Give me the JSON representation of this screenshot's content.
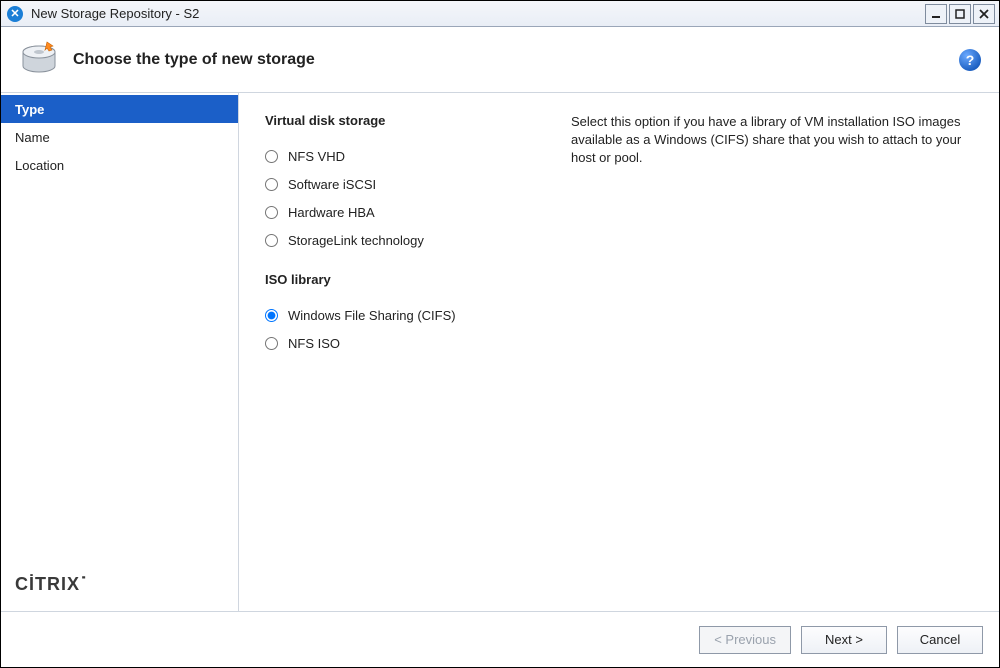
{
  "window": {
    "title": "New Storage Repository - S2"
  },
  "header": {
    "heading": "Choose the type of new storage"
  },
  "sidebar": {
    "steps": [
      {
        "label": "Type",
        "active": true
      },
      {
        "label": "Name",
        "active": false
      },
      {
        "label": "Location",
        "active": false
      }
    ],
    "brand": "CİTRIX"
  },
  "options": {
    "group1_title": "Virtual disk storage",
    "group1": [
      {
        "key": "nfs_vhd",
        "label": "NFS VHD",
        "selected": false
      },
      {
        "key": "sw_iscsi",
        "label": "Software iSCSI",
        "selected": false
      },
      {
        "key": "hw_hba",
        "label": "Hardware HBA",
        "selected": false
      },
      {
        "key": "storagelink",
        "label": "StorageLink technology",
        "selected": false
      }
    ],
    "group2_title": "ISO library",
    "group2": [
      {
        "key": "cifs",
        "label": "Windows File Sharing (CIFS)",
        "selected": true
      },
      {
        "key": "nfs_iso",
        "label": "NFS ISO",
        "selected": false
      }
    ]
  },
  "description": "Select this option if you have a library of VM installation ISO images available as a Windows (CIFS) share that you wish to attach to your host or pool.",
  "footer": {
    "previous": "< Previous",
    "next": "Next >",
    "cancel": "Cancel",
    "previous_enabled": false
  }
}
